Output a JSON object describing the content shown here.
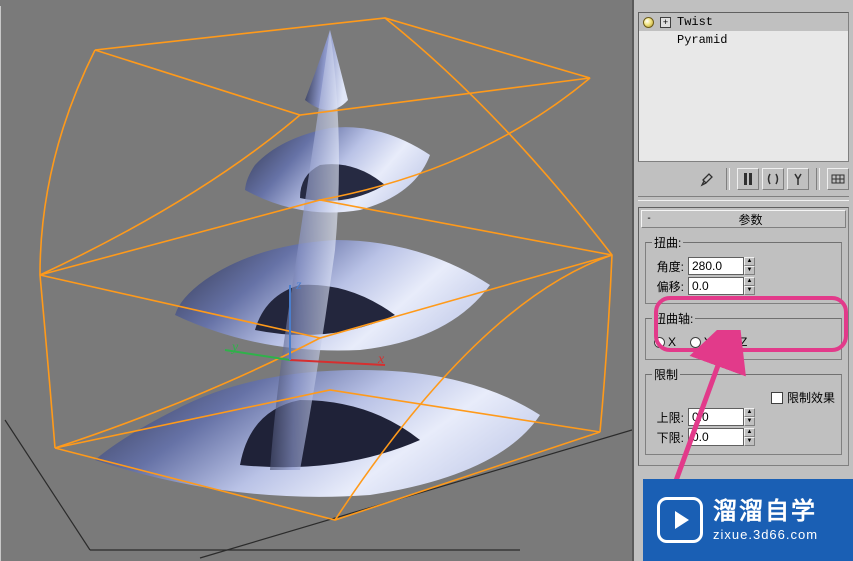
{
  "modifier_stack": {
    "items": [
      {
        "label": "Twist",
        "is_modifier": true,
        "expandable": true
      },
      {
        "label": "Pyramid",
        "is_modifier": false,
        "expandable": false
      }
    ]
  },
  "rollup": {
    "title": "参数",
    "toggle": "-"
  },
  "twist": {
    "group_label": "扭曲:",
    "angle_label": "角度:",
    "angle_value": "280.0",
    "bias_label": "偏移:",
    "bias_value": "0.0"
  },
  "twist_axis": {
    "group_label": "扭曲轴:",
    "options": [
      {
        "label": "X",
        "checked": false
      },
      {
        "label": "Y",
        "checked": false
      },
      {
        "label": "Z",
        "checked": true
      }
    ]
  },
  "limits": {
    "group_label": "限制",
    "effect_label": "限制效果",
    "effect_checked": false,
    "upper_label": "上限:",
    "upper_value": "0.0",
    "lower_label": "下限:",
    "lower_value": "0.0"
  },
  "gizmo": {
    "x_label": "x",
    "y_label": "y",
    "z_label": "z"
  },
  "watermark": {
    "title": "溜溜自学",
    "url": "zixue.3d66.com"
  }
}
